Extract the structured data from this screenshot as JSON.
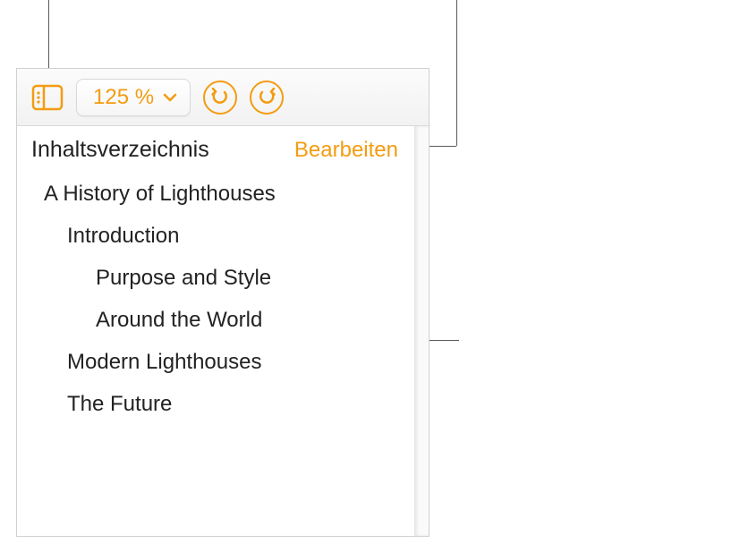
{
  "toolbar": {
    "zoom_value": "125 %"
  },
  "sidebar": {
    "title": "Inhaltsverzeichnis",
    "edit_label": "Bearbeiten"
  },
  "toc": {
    "items": [
      {
        "label": "A History of Lighthouses",
        "level": 0
      },
      {
        "label": "Introduction",
        "level": 1
      },
      {
        "label": "Purpose and Style",
        "level": 2
      },
      {
        "label": "Around the World",
        "level": 2
      },
      {
        "label": "Modern Lighthouses",
        "level": 1
      },
      {
        "label": "The Future",
        "level": 1
      }
    ]
  },
  "colors": {
    "accent": "#f39c12"
  }
}
